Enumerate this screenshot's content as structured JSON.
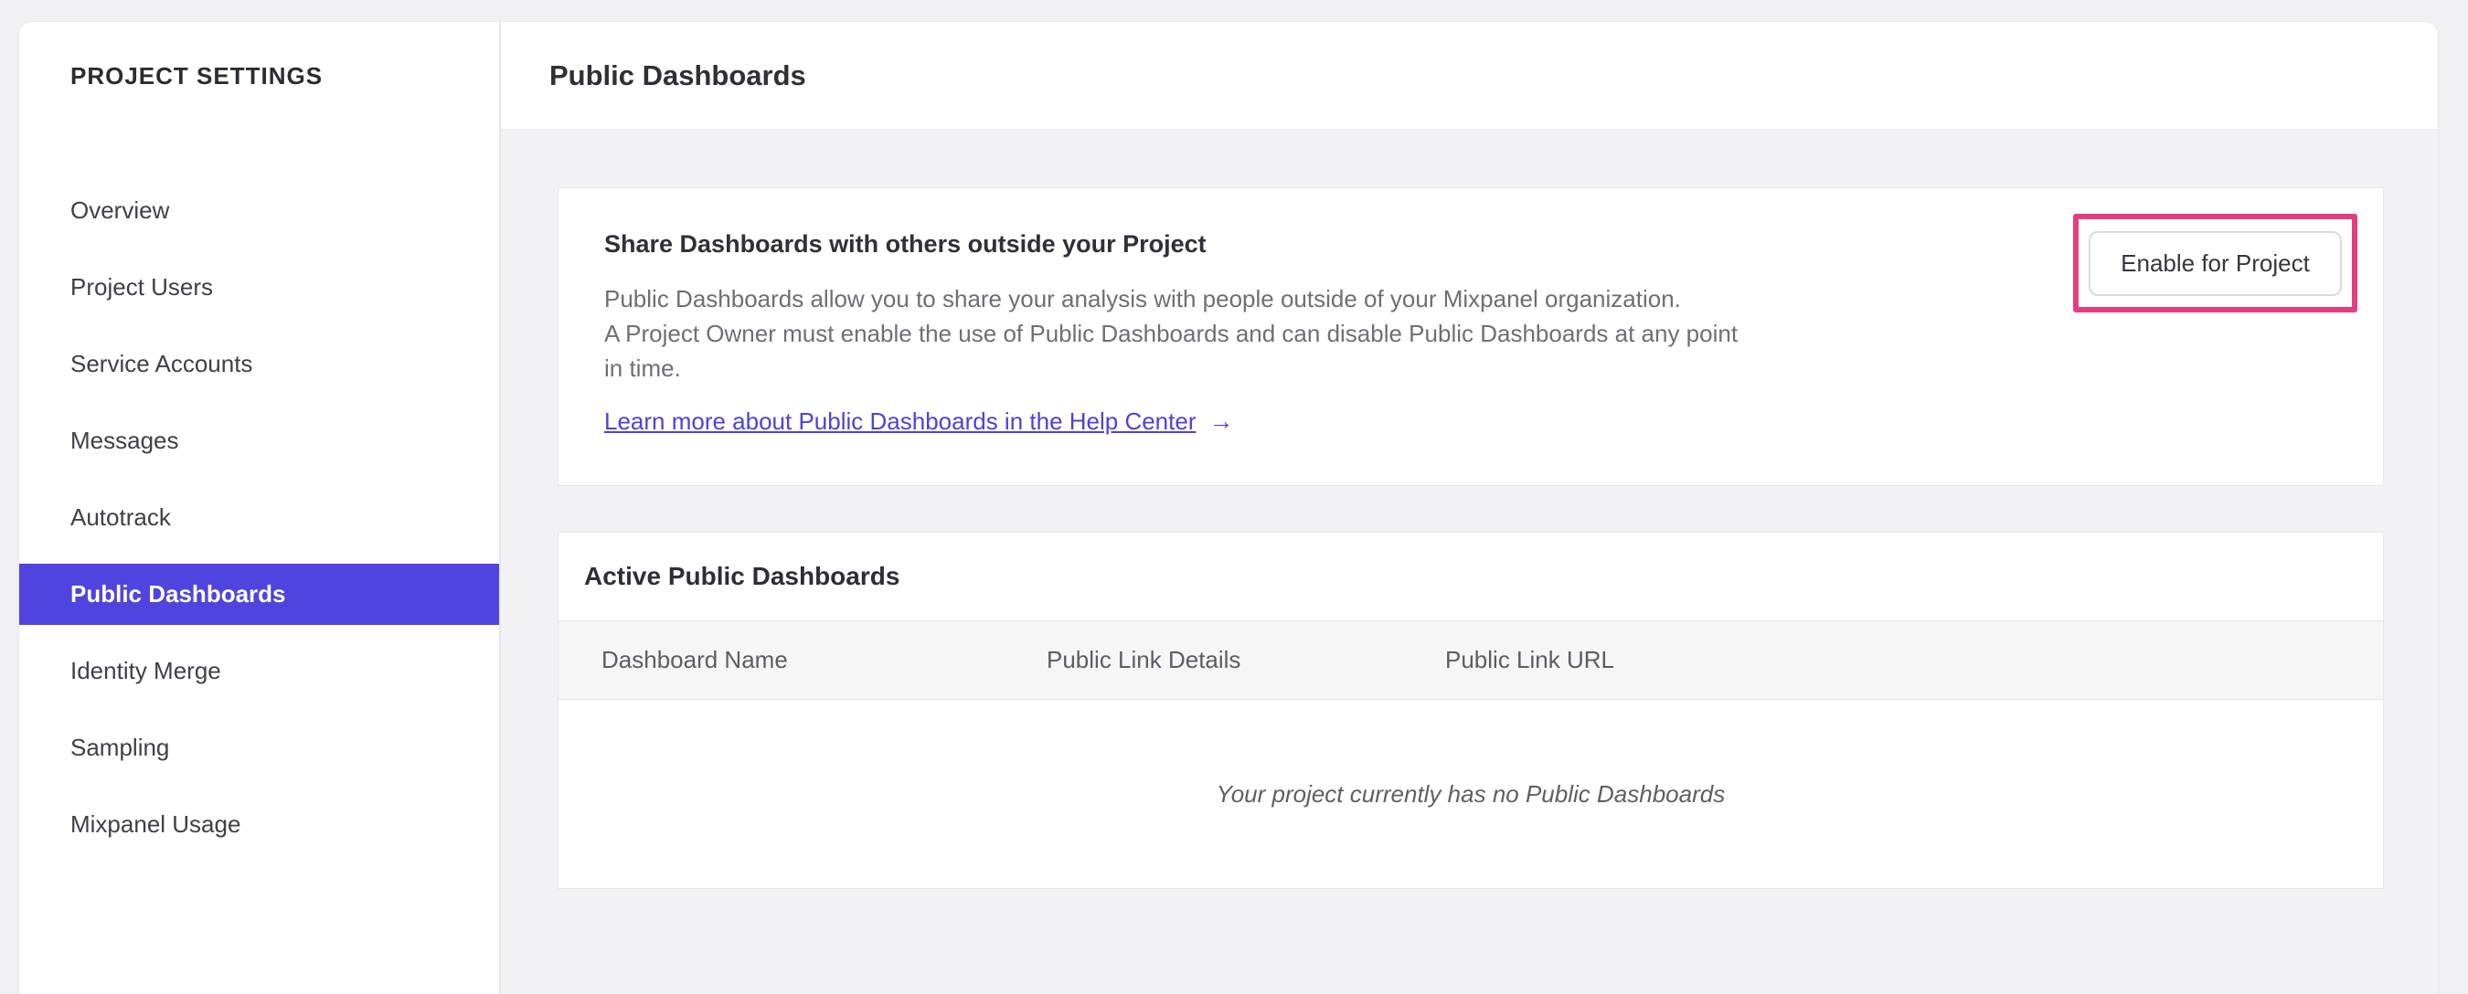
{
  "colors": {
    "accent": "#4f44de",
    "link": "#4b42dd",
    "annotation": "#e43e80"
  },
  "sidebar": {
    "title": "PROJECT SETTINGS",
    "items": [
      {
        "label": "Overview",
        "selected": false
      },
      {
        "label": "Project Users",
        "selected": false
      },
      {
        "label": "Service Accounts",
        "selected": false
      },
      {
        "label": "Messages",
        "selected": false
      },
      {
        "label": "Autotrack",
        "selected": false
      },
      {
        "label": "Public Dashboards",
        "selected": true
      },
      {
        "label": "Identity Merge",
        "selected": false
      },
      {
        "label": "Sampling",
        "selected": false
      },
      {
        "label": "Mixpanel Usage",
        "selected": false
      }
    ]
  },
  "header": {
    "title": "Public Dashboards"
  },
  "share_card": {
    "heading": "Share Dashboards with others outside your Project",
    "body_lines": [
      "Public Dashboards allow you to share your analysis with people outside of your Mixpanel organization.",
      "A Project Owner must enable the use of Public Dashboards and can disable Public Dashboards at any point",
      "in time."
    ],
    "link_label": "Learn more about Public Dashboards in the Help Center",
    "link_arrow": "→",
    "button_label": "Enable for Project"
  },
  "dashboards_card": {
    "heading": "Active Public Dashboards",
    "columns": [
      "Dashboard Name",
      "Public Link Details",
      "Public Link URL"
    ],
    "rows": [],
    "empty_message": "Your project currently has no Public Dashboards"
  }
}
